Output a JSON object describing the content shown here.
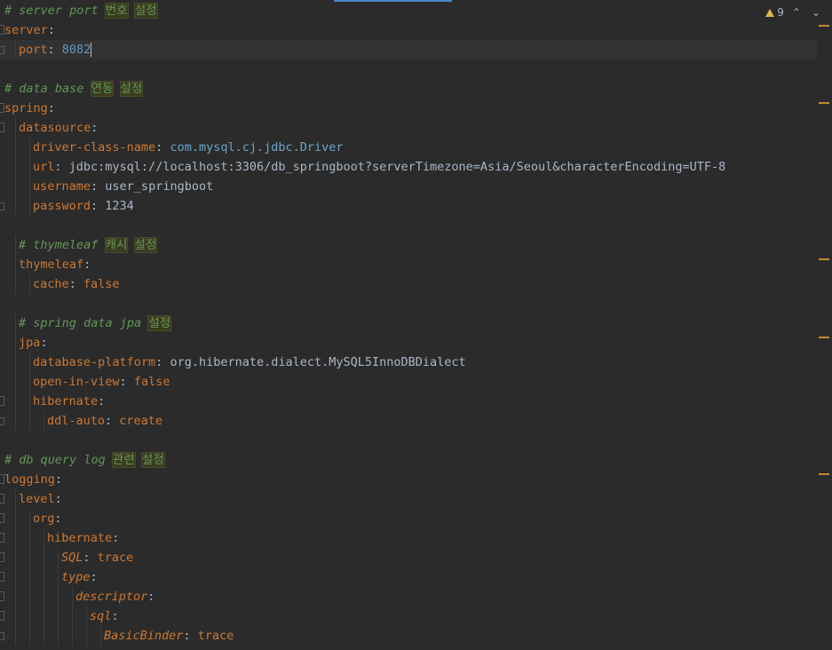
{
  "status": {
    "warning_count": "9",
    "up_symbol": "⌃",
    "down_symbol": "⌄"
  },
  "colors": {
    "background": "#2b2b2b",
    "key": "#cc7832",
    "comment": "#629755",
    "number": "#6897bb",
    "warning": "#e0b64a"
  },
  "lines": [
    {
      "type": "comment",
      "indent": 0,
      "text": "# server port ",
      "hl": [
        "번호",
        "설정"
      ]
    },
    {
      "type": "key",
      "indent": 0,
      "key": "server",
      "fold": "open"
    },
    {
      "type": "kv",
      "indent": 1,
      "key": "port",
      "value": "8082",
      "vclass": "val-num",
      "current": true,
      "fold": "close"
    },
    {
      "type": "blank"
    },
    {
      "type": "comment",
      "indent": 0,
      "text": "# data base ",
      "hl": [
        "연동",
        "설정"
      ]
    },
    {
      "type": "key",
      "indent": 0,
      "key": "spring",
      "fold": "open"
    },
    {
      "type": "key",
      "indent": 1,
      "key": "datasource",
      "fold": "open"
    },
    {
      "type": "kv",
      "indent": 2,
      "key": "driver-class-name",
      "value": "com.mysql.cj.jdbc.Driver",
      "vclass": "val-class"
    },
    {
      "type": "kv",
      "indent": 2,
      "key": "url",
      "value": "jdbc:mysql://localhost:3306/db_springboot?serverTimezone=Asia/Seoul&characterEncoding=UTF-8",
      "vclass": "val"
    },
    {
      "type": "kv",
      "indent": 2,
      "key": "username",
      "value": "user_springboot",
      "vclass": "val"
    },
    {
      "type": "kv",
      "indent": 2,
      "key": "password",
      "value": "1234",
      "vclass": "val",
      "fold": "close"
    },
    {
      "type": "blank"
    },
    {
      "type": "comment",
      "indent": 1,
      "text": "# thymeleaf ",
      "hl": [
        "캐시",
        "설정"
      ]
    },
    {
      "type": "key",
      "indent": 1,
      "key": "thymeleaf"
    },
    {
      "type": "kv",
      "indent": 2,
      "key": "cache",
      "value": "false",
      "vclass": "val-kw"
    },
    {
      "type": "blank"
    },
    {
      "type": "comment",
      "indent": 1,
      "text": "# spring data jpa ",
      "hl": [
        "설정"
      ]
    },
    {
      "type": "key",
      "indent": 1,
      "key": "jpa"
    },
    {
      "type": "kv",
      "indent": 2,
      "key": "database-platform",
      "value": "org.hibernate.dialect.MySQL5InnoDBDialect",
      "vclass": "val"
    },
    {
      "type": "kv",
      "indent": 2,
      "key": "open-in-view",
      "value": "false",
      "vclass": "val-kw"
    },
    {
      "type": "key",
      "indent": 2,
      "key": "hibernate",
      "fold": "open"
    },
    {
      "type": "kv",
      "indent": 3,
      "key": "ddl-auto",
      "value": "create",
      "vclass": "val-kw",
      "fold": "close"
    },
    {
      "type": "blank"
    },
    {
      "type": "comment",
      "indent": 0,
      "text": "# db query log ",
      "hl": [
        "관련",
        "설정"
      ]
    },
    {
      "type": "key",
      "indent": 0,
      "key": "logging",
      "fold": "open"
    },
    {
      "type": "key",
      "indent": 1,
      "key": "level",
      "fold": "open"
    },
    {
      "type": "key",
      "indent": 2,
      "key": "org",
      "fold": "open"
    },
    {
      "type": "key",
      "indent": 3,
      "key": "hibernate",
      "fold": "open"
    },
    {
      "type": "kv",
      "indent": 4,
      "key": "SQL",
      "value": "trace",
      "vclass": "val-kw",
      "italic": true,
      "fold": "open"
    },
    {
      "type": "key",
      "indent": 4,
      "key": "type",
      "italic": true,
      "fold": "open"
    },
    {
      "type": "key",
      "indent": 5,
      "key": "descriptor",
      "italic": true,
      "fold": "open"
    },
    {
      "type": "key",
      "indent": 6,
      "key": "sql",
      "italic": true,
      "fold": "open"
    },
    {
      "type": "kv",
      "indent": 7,
      "key": "BasicBinder",
      "value": "trace",
      "vclass": "val-kw",
      "italic": true,
      "fold": "close"
    }
  ]
}
